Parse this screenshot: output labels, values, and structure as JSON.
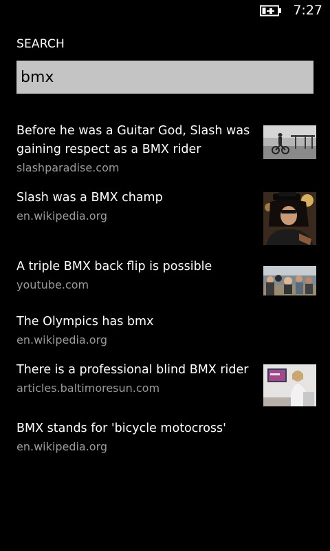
{
  "status": {
    "time": "7:27"
  },
  "header": {
    "title": "SEARCH"
  },
  "search": {
    "value": "bmx"
  },
  "results": [
    {
      "title": "Before he was a Guitar God, Slash was gaining respect as a BMX rider",
      "source": "slashparadise.com",
      "thumbnail": "rider-photo-grayscale"
    },
    {
      "title": "Slash was a BMX champ",
      "source": "en.wikipedia.org",
      "thumbnail": "slash-portrait"
    },
    {
      "title": "A triple BMX back flip is possible",
      "source": "youtube.com",
      "thumbnail": "bmx-crowd-photo"
    },
    {
      "title": "The Olympics has bmx",
      "source": "en.wikipedia.org"
    },
    {
      "title": "There is a professional blind BMX rider",
      "source": "articles.baltimoresun.com",
      "thumbnail": "interview-photo"
    },
    {
      "title": "BMX stands for 'bicycle motocross'",
      "source": "en.wikipedia.org"
    }
  ],
  "colors": {
    "background": "#000000",
    "search_box": "#c4c4c4",
    "source_text": "#9a9a9a"
  }
}
